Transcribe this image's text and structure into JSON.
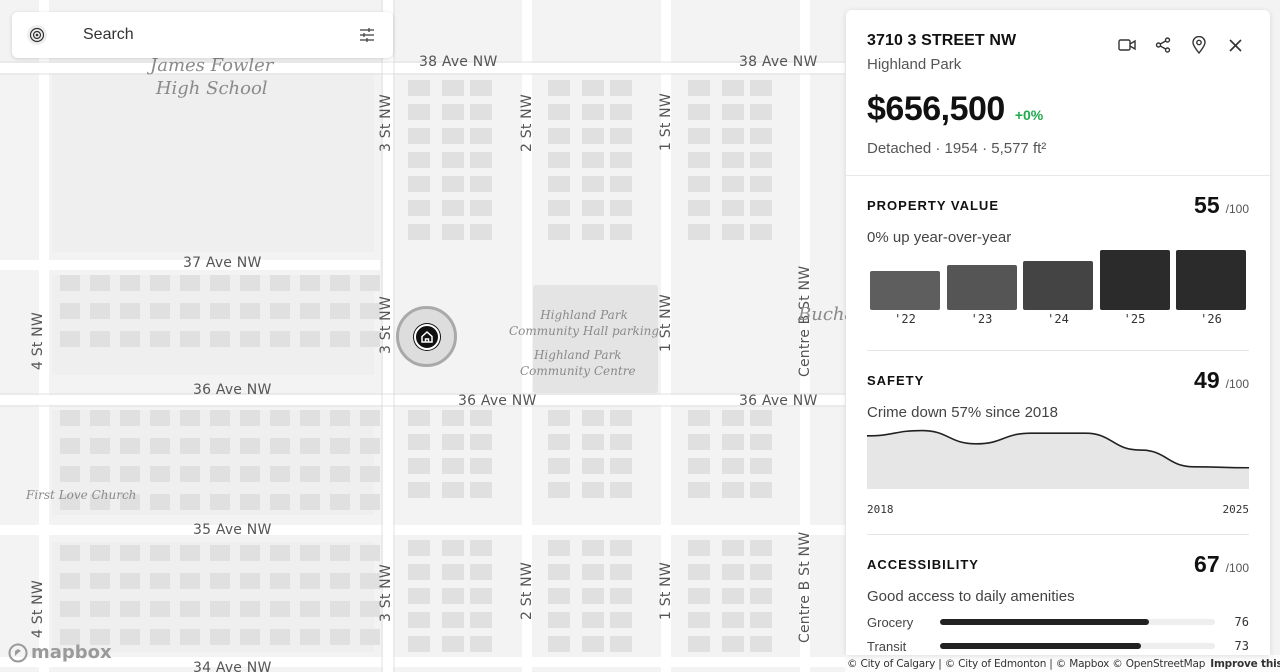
{
  "search": {
    "placeholder": "Search"
  },
  "map": {
    "street_labels": [
      "38 Ave NW",
      "38 Ave NW",
      "37 Ave NW",
      "36 Ave NW",
      "36 Ave NW",
      "36 Ave NW",
      "35 Ave NW",
      "34 Ave NW",
      "3 St NW",
      "3 St NW",
      "3 St NW",
      "2 St NW",
      "2 St NW",
      "1 St NW",
      "1 St NW",
      "1 St NW",
      "Centre B St NW",
      "Centre B St NW",
      "4 St NW",
      "4 St NW"
    ],
    "poi_school": "James Fowler\nHigh School",
    "poi_hall": "Highland Park\nCommunity Hall parking",
    "poi_centre": "Highland Park\nCommunity Centre",
    "poi_church": "First Love Church",
    "poi_partial": "Bucha",
    "logo": "mapbox"
  },
  "attribution": {
    "text": "© City of Calgary | © City of Edmonton | © Mapbox © OpenStreetMap",
    "improve": "Improve this map"
  },
  "panel": {
    "address": "3710 3 STREET NW",
    "neighbourhood": "Highland Park",
    "price": "$656,500",
    "change": "+0%",
    "change_color": "#1eaa4a",
    "details": "Detached · 1954 · 5,577 ft²",
    "actions": [
      "video-icon",
      "share-icon",
      "location-pin-icon",
      "close-icon"
    ]
  },
  "property_value": {
    "title": "PROPERTY VALUE",
    "score": "55",
    "max": "/100",
    "description": "0% up year-over-year"
  },
  "safety": {
    "title": "SAFETY",
    "score": "49",
    "max": "/100",
    "description": "Crime down 57% since 2018",
    "x_start": "2018",
    "x_end": "2025"
  },
  "accessibility": {
    "title": "ACCESSIBILITY",
    "score": "67",
    "max": "/100",
    "description": "Good access to daily amenities",
    "rows": [
      {
        "label": "Grocery",
        "value": "76",
        "fill": 0.76
      },
      {
        "label": "Transit",
        "value": "73",
        "fill": 0.73
      }
    ]
  },
  "chart_data": [
    {
      "type": "bar",
      "categories": [
        "'22",
        "'23",
        "'24",
        "'25",
        "'26"
      ],
      "values": [
        40,
        46,
        51,
        62,
        62
      ],
      "colors": [
        "#5e5e5e",
        "#555555",
        "#444444",
        "#2b2b2b",
        "#2b2b2b"
      ]
    },
    {
      "type": "area",
      "x": [
        2018,
        2019,
        2020,
        2021,
        2022,
        2023,
        2024,
        2025
      ],
      "values": [
        60,
        66,
        51,
        63,
        63,
        44,
        25,
        24
      ]
    }
  ]
}
